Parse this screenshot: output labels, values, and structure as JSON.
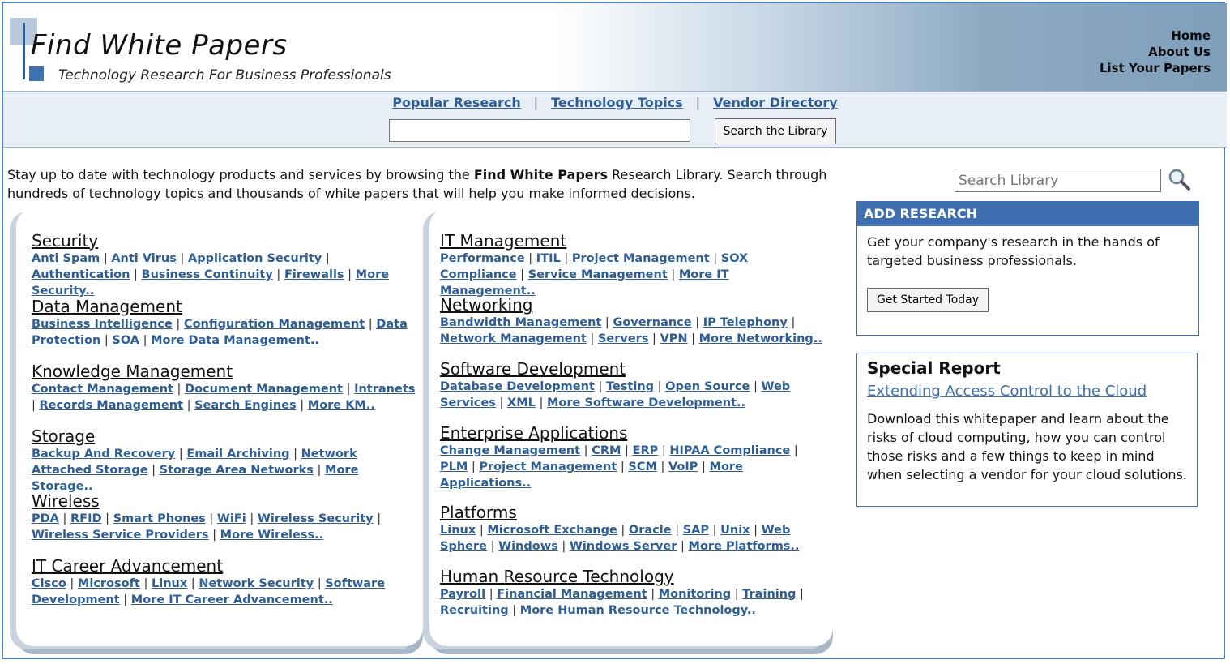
{
  "header": {
    "logo_title": "Find White Papers",
    "logo_tagline": "Technology Research For Business Professionals",
    "toplinks": [
      "Home",
      "About Us",
      "List Your Papers"
    ]
  },
  "nav": {
    "items": [
      "Popular Research",
      "Technology Topics",
      "Vendor Directory"
    ],
    "separator": "|"
  },
  "library_search": {
    "input_value": "",
    "button_label": "Search the Library"
  },
  "intro": {
    "before": "Stay up to date with technology products and services by browsing the ",
    "bold": "Find White Papers",
    "after": " Research Library. Search through hundreds of technology topics and thousands of white papers that will help you make informed decisions."
  },
  "left_categories": [
    {
      "title": "Security",
      "links": [
        "Anti Spam",
        "Anti Virus",
        "Application Security",
        "Authentication",
        "Business Continuity",
        "Firewalls",
        "More Security.."
      ]
    },
    {
      "title": "Data Management",
      "links": [
        "Business Intelligence",
        "Configuration Management",
        "Data Protection",
        "SOA",
        "More Data Management.."
      ]
    },
    {
      "title": "Knowledge Management",
      "links": [
        "Contact Management",
        "Document Management",
        "Intranets",
        "Records Management",
        "Search Engines",
        "More KM.."
      ]
    },
    {
      "title": "Storage",
      "links": [
        "Backup And Recovery",
        "Email Archiving",
        "Network Attached Storage",
        "Storage Area Networks",
        "More Storage.."
      ]
    },
    {
      "title": "Wireless",
      "links": [
        "PDA",
        "RFID",
        "Smart Phones",
        "WiFi",
        "Wireless Security",
        "Wireless Service Providers",
        "More Wireless.."
      ]
    },
    {
      "title": "IT Career Advancement",
      "links": [
        "Cisco",
        "Microsoft",
        "Linux",
        "Network Security",
        "Software Development",
        "More IT Career Advancement.."
      ]
    }
  ],
  "right_categories": [
    {
      "title": "IT Management",
      "links": [
        "Performance",
        "ITIL",
        "Project Management",
        "SOX Compliance",
        "Service Management",
        "More IT Management.."
      ]
    },
    {
      "title": "Networking",
      "links": [
        "Bandwidth Management",
        "Governance",
        "IP Telephony",
        "Network Management",
        "Servers",
        "VPN",
        "More Networking.."
      ]
    },
    {
      "title": "Software Development",
      "links": [
        "Database Development",
        "Testing",
        "Open Source",
        "Web Services",
        "XML",
        "More Software Development.."
      ]
    },
    {
      "title": "Enterprise Applications",
      "links": [
        "Change Management",
        "CRM",
        "ERP",
        "HIPAA Compliance",
        "PLM",
        "Project Management",
        "SCM",
        "VoIP",
        "More Applications.."
      ]
    },
    {
      "title": "Platforms",
      "links": [
        "Linux",
        "Microsoft Exchange",
        "Oracle",
        "SAP",
        "Unix",
        "Web Sphere",
        "Windows",
        "Windows Server",
        "More Platforms.."
      ]
    },
    {
      "title": "Human Resource Technology",
      "links": [
        "Payroll",
        "Financial Management",
        "Monitoring",
        "Training",
        "Recruiting",
        "More Human Resource Technology.."
      ]
    }
  ],
  "sidebar": {
    "search_placeholder": "Search Library",
    "search_icon": "magnifier-icon",
    "add_research": {
      "header": "ADD RESEARCH",
      "text": "Get your company's research in the hands of targeted business professionals.",
      "button_label": "Get Started Today"
    },
    "special_report": {
      "title": "Special Report",
      "link": "Extending Access Control to the Cloud",
      "description": "Download this whitepaper and learn about the risks of cloud computing, how you can control those risks and a few things to keep in mind when selecting a vendor for your cloud solutions."
    }
  },
  "colors": {
    "accent": "#3f6fae",
    "link": "#2f5d96",
    "nav_bg": "#e8eef5"
  }
}
